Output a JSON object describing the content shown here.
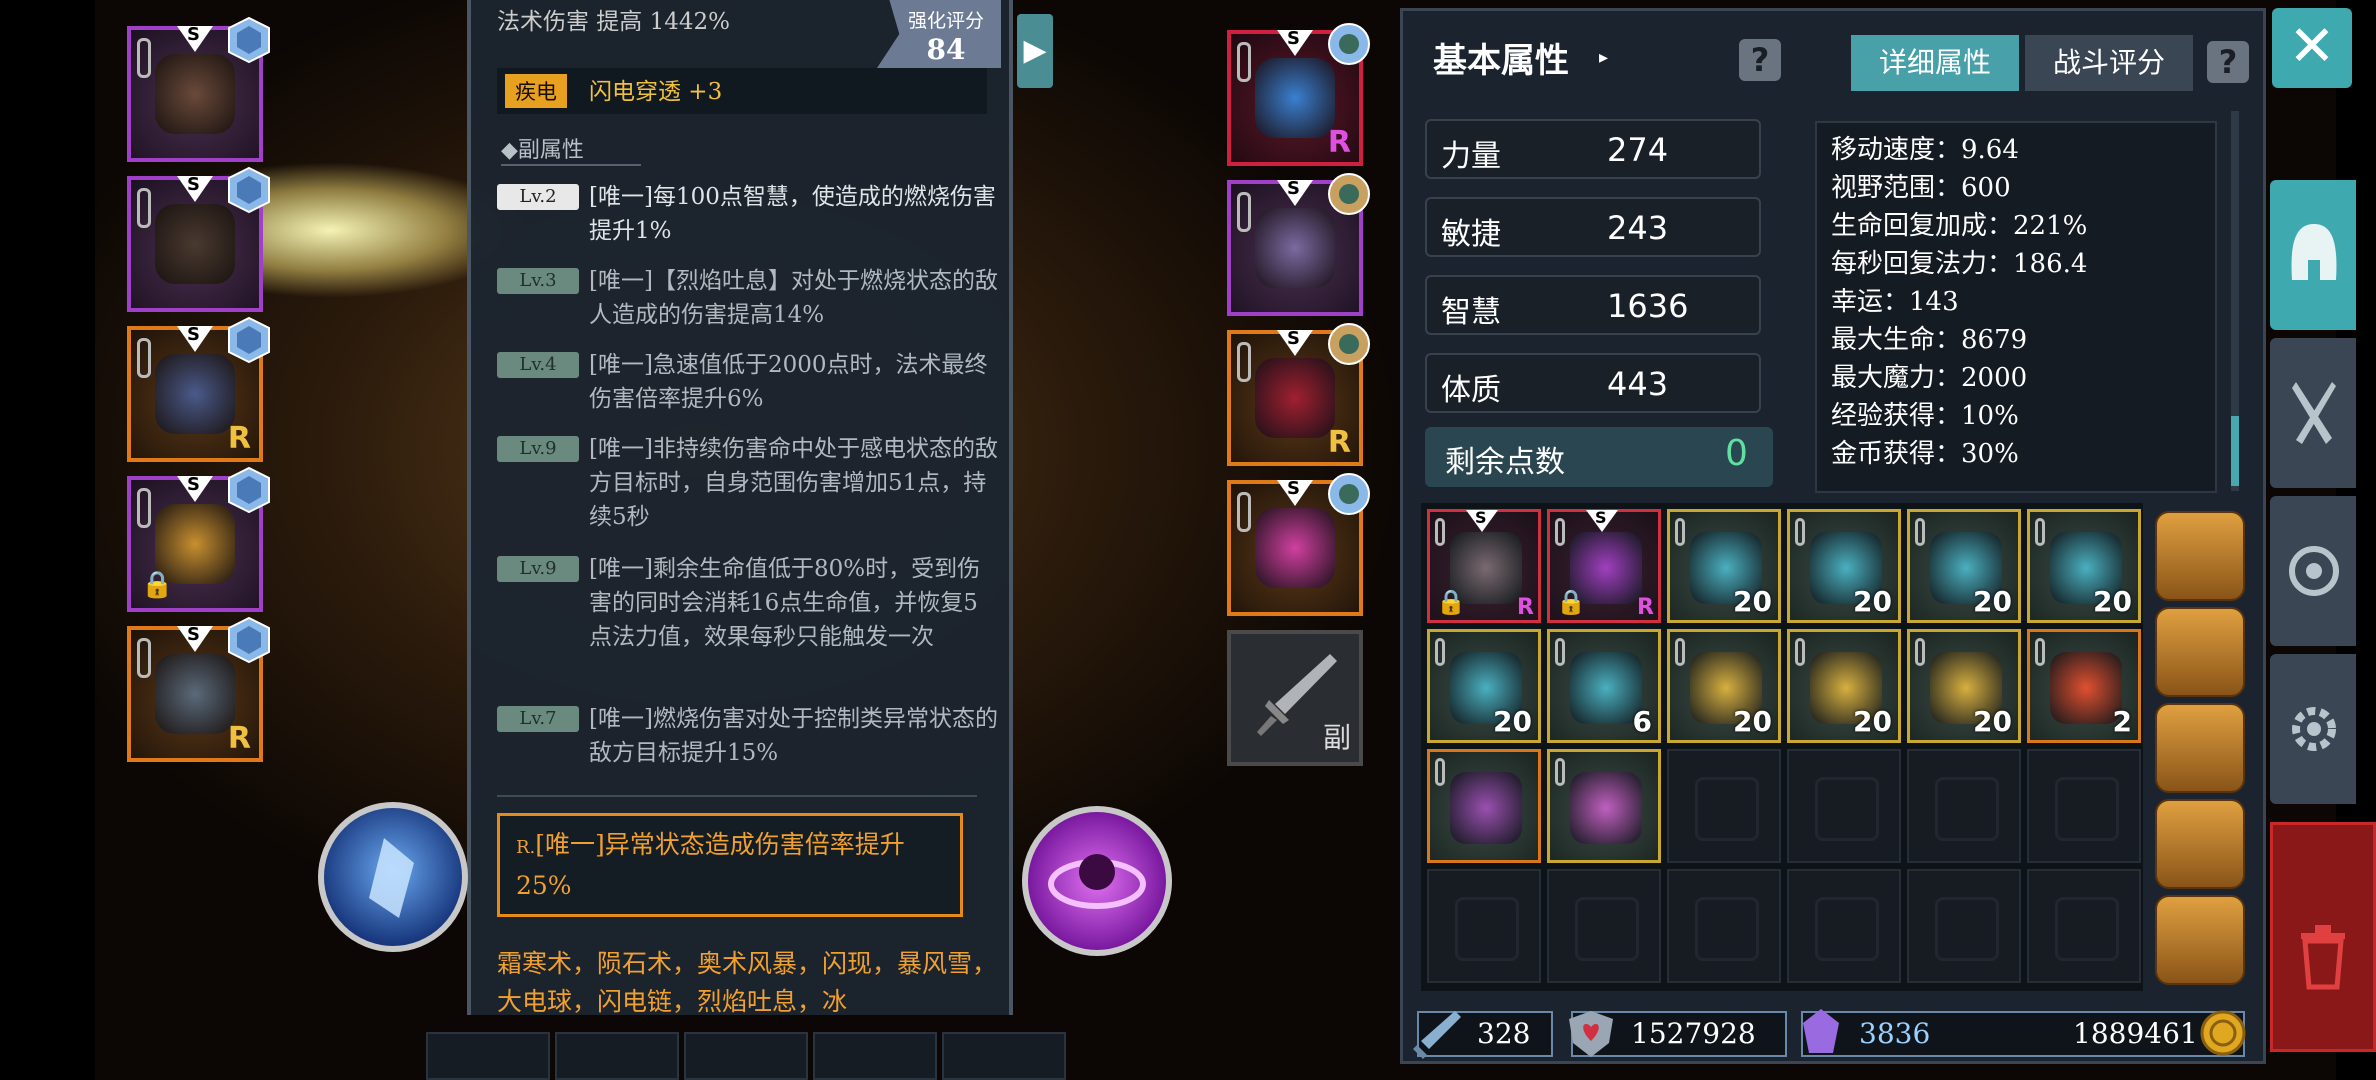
{
  "tooltip": {
    "top_line": "法术伤害 提高 1442%",
    "score_label": "强化评分",
    "score_value": "84",
    "special_tag": "疾电",
    "special_text": "闪电穿透 +3",
    "subhead": "◆副属性",
    "affixes": [
      {
        "lv": "Lv.2",
        "text": "[唯一]每100点智慧，使造成的燃烧伤害提升1%",
        "active": true
      },
      {
        "lv": "Lv.3",
        "text": "[唯一]【烈焰吐息】对处于燃烧状态的敌人造成的伤害提高14%",
        "active": false
      },
      {
        "lv": "Lv.4",
        "text": "[唯一]急速值低于2000点时，法术最终伤害倍率提升6%",
        "active": false
      },
      {
        "lv": "Lv.9",
        "text": "[唯一]非持续伤害命中处于感电状态的敌方目标时，自身范围伤害增加51点，持续5秒",
        "active": false
      },
      {
        "lv": "Lv.9",
        "text": "[唯一]剩余生命值低于80%时，受到伤害的同时会消耗16点生命值，并恢复5点法力值，效果每秒只能触发一次",
        "active": false
      },
      {
        "lv": "Lv.7",
        "text": "[唯一]燃烧伤害对处于控制类异常状态的敌方目标提升15%",
        "active": false
      }
    ],
    "legend_prefix": "R.",
    "legend_text": "[唯一]异常状态造成伤害倍率提升25%",
    "skills": "霜寒术，陨石术，奥术风暴，闪现，暴风雪，大电球，闪电链，烈焰吐息，冰"
  },
  "left_slots": [
    {
      "name": "helmet-slot",
      "letter": "S",
      "rarity": "",
      "locked": false
    },
    {
      "name": "armor-slot",
      "letter": "S",
      "rarity": "",
      "locked": false
    },
    {
      "name": "pants-slot",
      "letter": "S",
      "rarity": "R",
      "locked": false
    },
    {
      "name": "ring-slot",
      "letter": "S",
      "rarity": "",
      "locked": true
    },
    {
      "name": "belt-slot",
      "letter": "S",
      "rarity": "R",
      "locked": false
    }
  ],
  "right_slots": [
    {
      "name": "necklace-slot",
      "letter": "S",
      "rarity": "R"
    },
    {
      "name": "gloves-slot",
      "letter": "S",
      "rarity": ""
    },
    {
      "name": "boots-slot",
      "letter": "S",
      "rarity": "R"
    },
    {
      "name": "trinket-slot",
      "letter": "S",
      "rarity": ""
    }
  ],
  "offhand": {
    "label": "副"
  },
  "stats": {
    "title": "基本属性",
    "title_caret": "▸",
    "tab_detail": "详细属性",
    "tab_battle": "战斗评分",
    "help": "?",
    "base": [
      {
        "name": "力量",
        "value": "274"
      },
      {
        "name": "敏捷",
        "value": "243"
      },
      {
        "name": "智慧",
        "value": "1636"
      },
      {
        "name": "体质",
        "value": "443"
      }
    ],
    "remain_label": "剩余点数",
    "remain_value": "0",
    "detail": [
      "移动速度：9.64",
      "视野范围：600",
      "生命回复加成：221%",
      "每秒回复法力：186.4",
      "幸运：143",
      "最大生命：8679",
      "最大魔力：2000",
      "经验获得：10%",
      "金币获得：30%"
    ]
  },
  "inventory": {
    "rows": [
      [
        {
          "kind": "item",
          "style": "red",
          "art": "#7a6a70",
          "locked": true,
          "s": true,
          "r": "R",
          "count": ""
        },
        {
          "kind": "item",
          "style": "red",
          "art": "#a040c0",
          "locked": true,
          "s": true,
          "r": "R",
          "count": ""
        },
        {
          "kind": "item",
          "style": "gold",
          "art": "#4ab0c0",
          "count": "20"
        },
        {
          "kind": "item",
          "style": "gold",
          "art": "#4ab0c0",
          "count": "20"
        },
        {
          "kind": "item",
          "style": "gold",
          "art": "#4ab0c0",
          "count": "20"
        },
        {
          "kind": "item",
          "style": "gold",
          "art": "#4ab0c0",
          "count": "20"
        }
      ],
      [
        {
          "kind": "item",
          "style": "gold",
          "art": "#4ab0c0",
          "count": "20"
        },
        {
          "kind": "item",
          "style": "gold",
          "art": "#4ab0c0",
          "count": "6"
        },
        {
          "kind": "item",
          "style": "gold",
          "art": "#d8b040",
          "count": "20"
        },
        {
          "kind": "item",
          "style": "gold",
          "art": "#d8b040",
          "count": "20"
        },
        {
          "kind": "item",
          "style": "gold",
          "art": "#d8b040",
          "count": "20"
        },
        {
          "kind": "item",
          "style": "orange",
          "art": "#e05030",
          "count": "2"
        }
      ],
      [
        {
          "kind": "item",
          "style": "orange",
          "art": "#9a50b0",
          "count": ""
        },
        {
          "kind": "item",
          "style": "gold",
          "art": "#c060c0",
          "count": ""
        },
        {
          "kind": "empty"
        },
        {
          "kind": "empty"
        },
        {
          "kind": "empty"
        },
        {
          "kind": "empty"
        }
      ],
      [
        {
          "kind": "empty"
        },
        {
          "kind": "empty"
        },
        {
          "kind": "empty"
        },
        {
          "kind": "empty"
        },
        {
          "kind": "empty"
        },
        {
          "kind": "empty"
        }
      ]
    ],
    "bags": 5
  },
  "currency": {
    "sword_points": "328",
    "hearts": "1527928",
    "crystals": "3836",
    "gold": "1889461"
  },
  "close_label": "✕",
  "colors": {
    "accent": "#3eaab0",
    "gold": "#f0a030",
    "rarity_purple": "#a040c8",
    "rarity_orange": "#e07a18"
  }
}
